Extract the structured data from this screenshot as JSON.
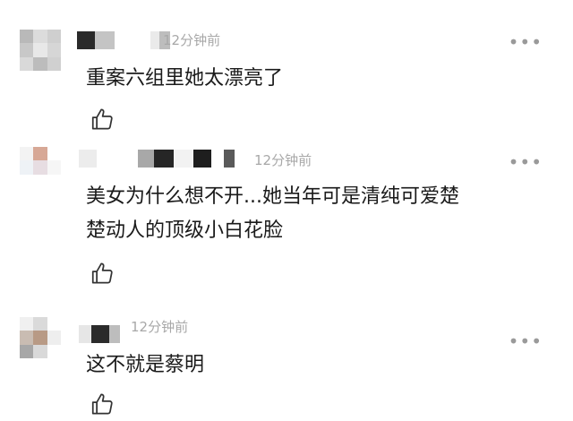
{
  "comments": [
    {
      "time": "12分钟前",
      "text_lines": [
        "重案六组里她太漂亮了"
      ],
      "more": "•••",
      "icon": "like-thumb-icon"
    },
    {
      "time": "12分钟前",
      "text_lines": [
        "美女为什么想不开...她当年可是清纯可爱楚",
        "楚动人的顶级小白花脸"
      ],
      "more": "•••",
      "icon": "like-thumb-icon"
    },
    {
      "time": "12分钟前",
      "text_lines": [
        "这不就是蔡明"
      ],
      "more": "•••",
      "icon": "like-thumb-icon"
    }
  ]
}
